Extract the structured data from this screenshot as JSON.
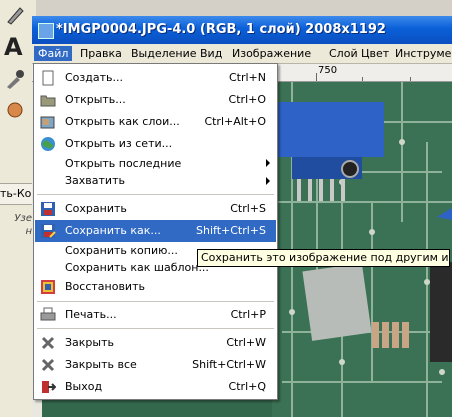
{
  "window": {
    "title": "*IMGP0004.JPG-4.0 (RGB, 1 слой) 2008x1192"
  },
  "menubar": [
    "Файл",
    "Правка",
    "Выделение",
    "Вид",
    "Изображение",
    "Слой",
    "Цвет",
    "Инструменты"
  ],
  "ruler": {
    "label": "750"
  },
  "toolbox": {
    "tab_label": "ть-Ко",
    "line1": "Узе",
    "line2": "н"
  },
  "file_menu": {
    "items": [
      {
        "label": "Создать...",
        "shortcut": "Ctrl+N"
      },
      {
        "label": "Открыть...",
        "shortcut": "Ctrl+O"
      },
      {
        "label": "Открыть как слои...",
        "shortcut": "Ctrl+Alt+O"
      },
      {
        "label": "Открыть из сети...",
        "shortcut": ""
      },
      {
        "label": "Открыть последние",
        "shortcut": ""
      },
      {
        "label": "Захватить",
        "shortcut": ""
      },
      {
        "label": "Сохранить",
        "shortcut": "Ctrl+S"
      },
      {
        "label": "Сохранить как...",
        "shortcut": "Shift+Ctrl+S"
      },
      {
        "label": "Сохранить копию...",
        "shortcut": ""
      },
      {
        "label": "Сохранить как шаблон...",
        "shortcut": ""
      },
      {
        "label": "Восстановить",
        "shortcut": ""
      },
      {
        "label": "Печать...",
        "shortcut": "Ctrl+P"
      },
      {
        "label": "Закрыть",
        "shortcut": "Ctrl+W"
      },
      {
        "label": "Закрыть все",
        "shortcut": "Shift+Ctrl+W"
      },
      {
        "label": "Выход",
        "shortcut": "Ctrl+Q"
      }
    ]
  },
  "tooltip": "Сохранить это изображение под другим именем",
  "colors": {
    "highlight": "#316ac5",
    "titlebar": "#0a5fd8",
    "pcb": "#33684c"
  }
}
